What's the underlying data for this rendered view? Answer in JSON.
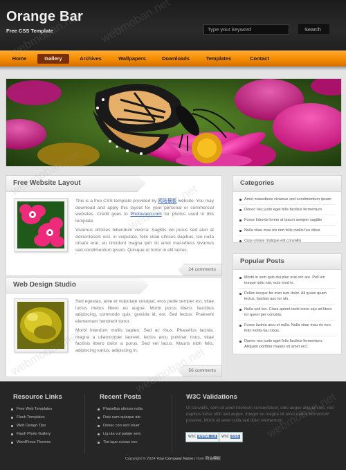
{
  "header": {
    "site_title": "Orange Bar",
    "site_subtitle": "Free CSS Template",
    "search_placeholder": "Type your keyword",
    "search_button": "Search"
  },
  "nav": {
    "items": [
      {
        "label": "Home"
      },
      {
        "label": "Gallery",
        "active": true
      },
      {
        "label": "Archives"
      },
      {
        "label": "Wallpapers"
      },
      {
        "label": "Downloads"
      },
      {
        "label": "Templates"
      },
      {
        "label": "Contact"
      }
    ]
  },
  "posts": [
    {
      "title": "Free Website Layout",
      "p1_a": "This is a free CSS template provided by ",
      "p1_link1": "网站模板",
      "p1_b": " website. You may download and apply this layout for your personal or commercial websites. Credit goes to ",
      "p1_link2": "Photovaco.com",
      "p1_c": " for photos used in this template.",
      "p2": "Vivamus ultricies bibendum viverra. Sagittis vel purus sed alun at dolnentesels orci. in vulputate, felis vitae ultrices dapibus, leo nulla omare erat, eu tincidunt magna ipm sit amet massdtess vivamus sed condimentum ipsum. Quisque ut tortor in elit luctus.",
      "comments": "24 comments"
    },
    {
      "title": "Web Design Studio",
      "p1": "Sed egestas, ante et vulputate volutpat, eros pede semper est, vitae luctus metus libero eu augue. Morbi purus libero, faucibus adipiscing, commodo quis, gravida id, est. Sed lectus. Praesent elementum hendrerit tortor.",
      "p2": "Morbi interdum mollis sapien. Sed ac risus. Phasellus lacinia, magna a ullamcorper laoreet, lectus arcu pulvinar risus, vitae facilisis libero dolor a purus. Sed vel lacus. Mauris nibh felis, adipiscing varius, adipiscing in.",
      "comments": "56 comments"
    }
  ],
  "sidebar": {
    "categories_title": "Categories",
    "categories": [
      "Amet massdtess vivamus sed condimentum ipsum",
      "Donec nec justo eget felis facilisis fermentum",
      "Fusce lobortis lorem at ipsum semper sagittis",
      "Nulla vitae mau nis non felis mollis fau cibus",
      "Cras ornare tristique elit convallis"
    ],
    "popular_title": "Popular Posts",
    "popular": [
      "Morbi in sem quis dui plac erat orn are. Pell len tesque odio nisi, euis mod in.",
      "Pellen tesque fer men tum dolor. Ali quam quam lectus, facilisis auc tor uln.",
      "Nulla sed leo. Class aptent taciti socio squ ad litora tor quent per conubia.",
      "Fusce lacinia arcu et nulla. Nulla vitae mau ris non felis mollis fau cibus.",
      "Donec nec justo eget felis facilisis fermentum. Aliquam porttitor mauris sit amet orci."
    ]
  },
  "footer": {
    "resource_title": "Resource Links",
    "resource_links": [
      "Free Web Templates",
      "Flash Templates",
      "Web Design Tips",
      "Flash Photo Gallery",
      "WordPress Themes"
    ],
    "recent_title": "Recent Posts",
    "recent_posts": [
      "Phasellus ultrices nulla",
      "Duis nam quisque ate",
      "Donec con sect etuer",
      "Lig ula vul putate sem",
      "Tist ique cursus nec"
    ],
    "w3c_title": "W3C Validations",
    "w3c_text": "Ut convallis, sem sit amet interdum consectetuer, odio augue aliquam leo, nec dapibus tortor nibh sed augue. Integer eu magna sit amet metus fermentum posuere. Morbi sit amet nulla sed dolor elementum.",
    "badge_xhtml_a": "W3C",
    "badge_xhtml_b": "XHTML 1.0",
    "badge_css_a": "W3C",
    "badge_css_b": "CSS",
    "copyright_pre": "Copyright © 2024 ",
    "copyright_name": "Your Company Name",
    "copyright_mid": " | from ",
    "copyright_link": "网站模板"
  },
  "watermark": "webmoban.net",
  "colors": {
    "accent_orange": "#f28a00",
    "nav_active": "#7a2f08",
    "header_bg": "#222222",
    "footer_bg": "#262626",
    "page_bg": "#e4e4e4"
  },
  "icons": [
    "bullet-icon"
  ]
}
